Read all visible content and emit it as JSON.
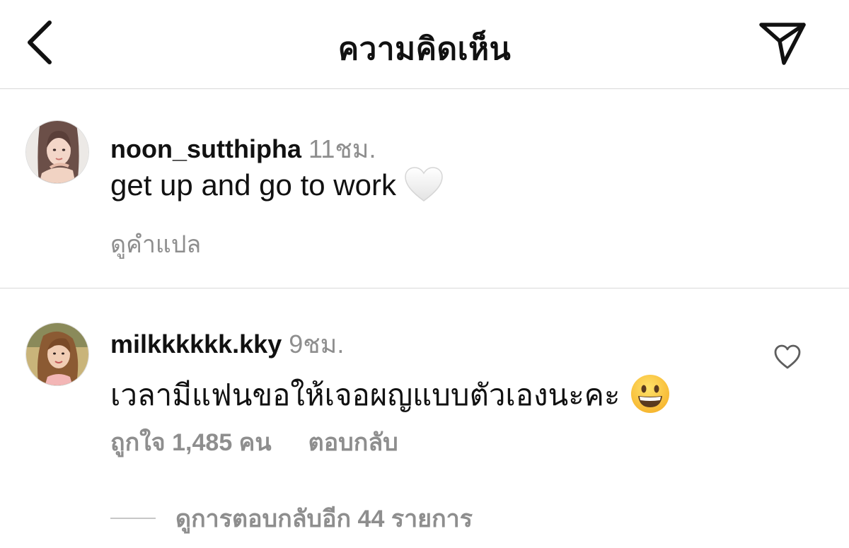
{
  "header": {
    "title": "ความคิดเห็น",
    "back_icon": "chevron-left-icon",
    "share_icon": "paper-plane-icon"
  },
  "caption": {
    "username": "noon_sutthipha",
    "time": "11ชม.",
    "text": "get up and go to work",
    "emoji": "white-heart-emoji",
    "see_translation": "ดูคำแปล"
  },
  "comment": {
    "username": "milkkkkkk.kky",
    "time": "9ชม.",
    "text": "เวลามีแฟนขอให้เจอผญแบบตัวเองนะคะ",
    "emoji": "grinning-face-emoji",
    "likes": "ถูกใจ 1,485 คน",
    "reply": "ตอบกลับ",
    "view_replies": "ดูการตอบกลับอีก 44 รายการ",
    "like_icon": "heart-outline-icon"
  },
  "colors": {
    "text": "#111111",
    "secondary": "#8e8e8e",
    "divider": "#d9d9d9",
    "emoji_yellow": "#ffcc33"
  }
}
